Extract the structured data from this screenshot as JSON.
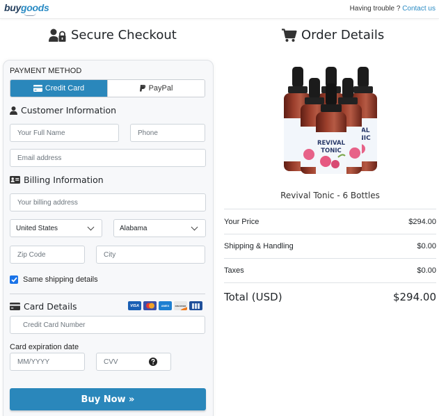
{
  "header": {
    "logo_part1": "buy",
    "logo_part2": "goods",
    "help_text": "Having trouble ?",
    "contact_link": "Contact us"
  },
  "headings": {
    "secure_checkout": "Secure Checkout",
    "order_details": "Order Details"
  },
  "payment": {
    "method_label": "PAYMENT METHOD",
    "tabs": [
      {
        "label": "Credit Card",
        "icon": "credit-card-icon",
        "active": true
      },
      {
        "label": "PayPal",
        "icon": "paypal-icon",
        "active": false
      }
    ]
  },
  "customer": {
    "title": "Customer Information",
    "full_name_placeholder": "Your Full Name",
    "phone_placeholder": "Phone",
    "email_placeholder": "Email address"
  },
  "billing": {
    "title": "Billing Information",
    "address_placeholder": "Your billing address",
    "country": "United States",
    "state": "Alabama",
    "zip_placeholder": "Zip Code",
    "city_placeholder": "City",
    "same_shipping_label": "Same shipping details",
    "same_shipping_checked": true
  },
  "card": {
    "title": "Card Details",
    "brands": [
      "VISA",
      "Mastercard",
      "AMEX",
      "DISCOVER",
      "JCB"
    ],
    "number_placeholder": "Credit Card Number",
    "expiration_label": "Card expiration date",
    "expiration_placeholder": "MM/YYYY",
    "cvv_placeholder": "CVV",
    "cvv_help_icon": "question-circle-icon"
  },
  "buy_button": "Buy Now »",
  "order": {
    "product_name": "Revival Tonic - 6 Bottles",
    "bottle_label_top": "REVIVAL",
    "bottle_label_bottom": "TONIC",
    "lines": [
      {
        "label": "Your Price",
        "value": "$294.00"
      },
      {
        "label": "Shipping & Handling",
        "value": "$0.00"
      },
      {
        "label": "Taxes",
        "value": "$0.00"
      }
    ],
    "total_label": "Total (USD)",
    "total_value": "$294.00"
  },
  "colors": {
    "primary": "#2a87bb",
    "brand_dark": "#26405e",
    "link": "#2a8bc4",
    "checkbox": "#1a73e8"
  }
}
